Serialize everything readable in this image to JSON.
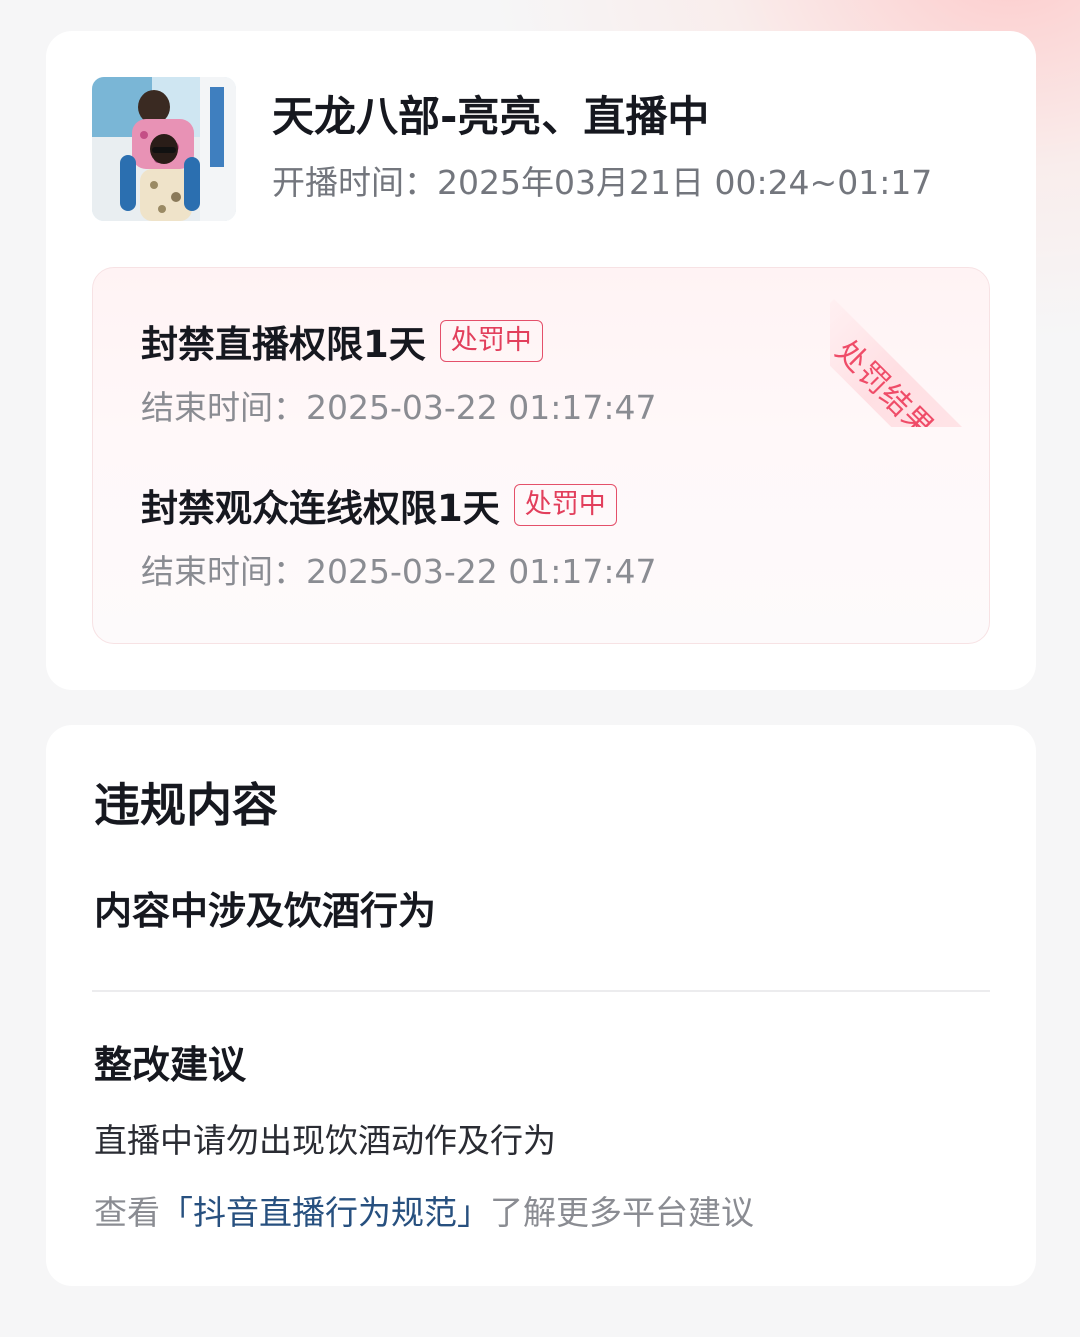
{
  "stream": {
    "title": "天龙八部-亮亮、直播中",
    "time_label": "开播时间：",
    "time_value": "2025年03月21日 00:24~01:17"
  },
  "penalty": {
    "ribbon_label": "处罚结果",
    "items": [
      {
        "name": "封禁直播权限1天",
        "status": "处罚中",
        "end_label": "结束时间：",
        "end_value": "2025-03-22 01:17:47"
      },
      {
        "name": "封禁观众连线权限1天",
        "status": "处罚中",
        "end_label": "结束时间：",
        "end_value": "2025-03-22 01:17:47"
      }
    ]
  },
  "violation": {
    "title": "违规内容",
    "content": "内容中涉及饮酒行为",
    "suggestion_title": "整改建议",
    "suggestion_text": "直播中请勿出现饮酒动作及行为",
    "guide_prefix": "查看",
    "guide_link": "「抖音直播行为规范」",
    "guide_suffix": "了解更多平台建议"
  },
  "colors": {
    "accent_red": "#e23f5c",
    "link_blue": "#27507f",
    "panel_bg": "#fff5f6"
  }
}
